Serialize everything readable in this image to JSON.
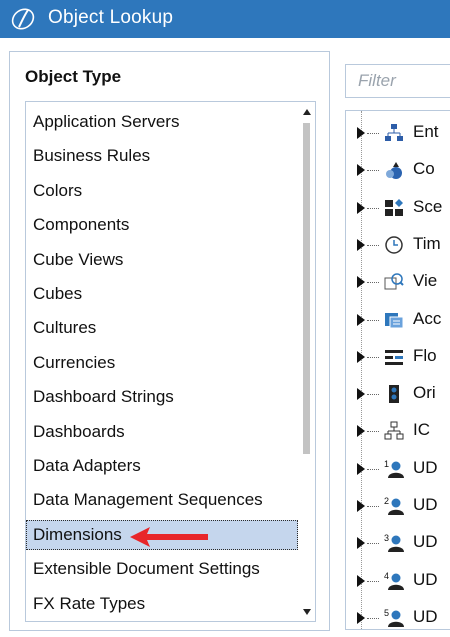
{
  "window": {
    "title": "Object Lookup"
  },
  "object_type": {
    "heading": "Object Type",
    "items": [
      {
        "label": "Application Servers"
      },
      {
        "label": "Business Rules"
      },
      {
        "label": "Colors"
      },
      {
        "label": "Components"
      },
      {
        "label": "Cube Views"
      },
      {
        "label": "Cubes"
      },
      {
        "label": "Cultures"
      },
      {
        "label": "Currencies"
      },
      {
        "label": "Dashboard Strings"
      },
      {
        "label": "Dashboards"
      },
      {
        "label": "Data Adapters"
      },
      {
        "label": "Data Management Sequences"
      },
      {
        "label": "Dimensions",
        "selected": true
      },
      {
        "label": "Extensible Document Settings"
      },
      {
        "label": "FX Rate Types"
      }
    ]
  },
  "filter": {
    "placeholder": "Filter"
  },
  "tree": {
    "items": [
      {
        "label": "Ent",
        "icon": "hierarchy-icon"
      },
      {
        "label": "Co",
        "icon": "consolidation-icon"
      },
      {
        "label": "Sce",
        "icon": "scenario-icon"
      },
      {
        "label": "Tim",
        "icon": "clock-icon"
      },
      {
        "label": "Vie",
        "icon": "view-icon"
      },
      {
        "label": "Acc",
        "icon": "account-icon"
      },
      {
        "label": "Flo",
        "icon": "flow-icon"
      },
      {
        "label": "Ori",
        "icon": "origin-icon"
      },
      {
        "label": "IC",
        "icon": "ic-hierarchy-icon"
      },
      {
        "label": "UD",
        "icon": "ud1-user-icon",
        "badge": "1"
      },
      {
        "label": "UD",
        "icon": "ud2-user-icon",
        "badge": "2"
      },
      {
        "label": "UD",
        "icon": "ud3-user-icon",
        "badge": "3"
      },
      {
        "label": "UD",
        "icon": "ud4-user-icon",
        "badge": "4"
      },
      {
        "label": "UD",
        "icon": "ud5-user-icon",
        "badge": "5"
      }
    ]
  },
  "colors": {
    "titlebar": "#2e77bc",
    "selection": "#c5d6ed",
    "annotation_arrow": "#e8262a"
  }
}
